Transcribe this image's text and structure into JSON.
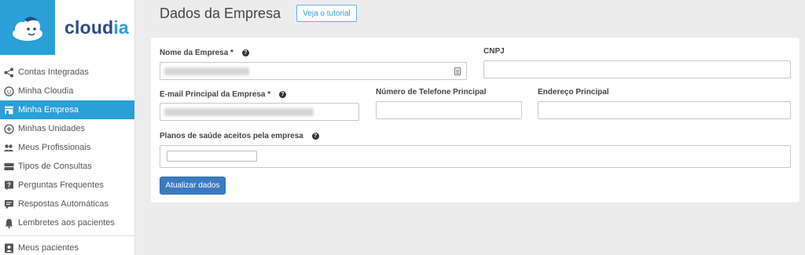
{
  "brand": {
    "name_part1": "cloud",
    "name_part2": "ia"
  },
  "sidebar": {
    "items": [
      {
        "label": "Contas Integradas"
      },
      {
        "label": "Minha Cloudia"
      },
      {
        "label": "Minha Empresa",
        "active": true
      },
      {
        "label": "Minhas Unidades"
      },
      {
        "label": "Meus Profissionais"
      },
      {
        "label": "Tipos de Consultas"
      },
      {
        "label": "Perguntas Frequentes"
      },
      {
        "label": "Respostas Automáticas"
      },
      {
        "label": "Lembretes aos pacientes"
      },
      {
        "label": "Meus pacientes"
      }
    ]
  },
  "header": {
    "title": "Dados da Empresa",
    "tutorial_label": "Veja o tutorial"
  },
  "form": {
    "company_name_label": "Nome da Empresa",
    "required_mark": "*",
    "cnpj_label": "CNPJ",
    "email_label": "E-mail Principal da Empresa",
    "phone_label": "Número de Telefone Principal",
    "address_label": "Endereço Principal",
    "health_plans_label": "Planos de saúde aceitos pela empresa",
    "update_button": "Atualizar dados"
  },
  "colors": {
    "accent": "#2a9fd8",
    "primary_button": "#3a7bbf",
    "brand_dark": "#2b4c7e"
  }
}
